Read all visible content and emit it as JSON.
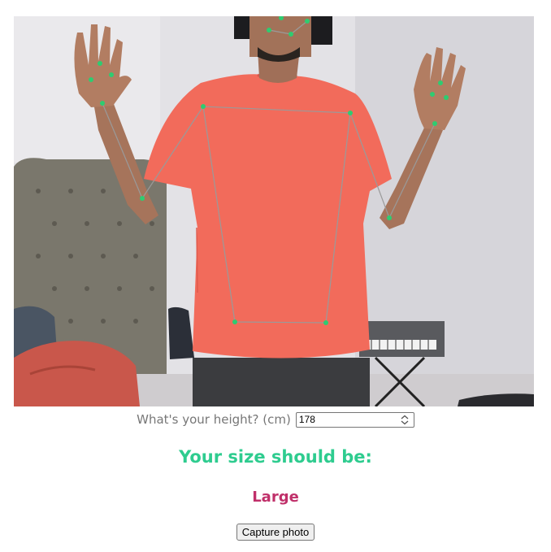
{
  "camera": {
    "pose_point_color": "#2ecc71",
    "pose_line_color": "#9a9a9a"
  },
  "height_form": {
    "label": "What's your height? (cm)",
    "value": "178"
  },
  "result": {
    "heading": "Your size should be:",
    "size": "Large"
  },
  "actions": {
    "capture_label": "Capture photo"
  },
  "colors": {
    "heading": "#2ecc8f",
    "size": "#c0306a",
    "shirt": "#f26b5b"
  }
}
